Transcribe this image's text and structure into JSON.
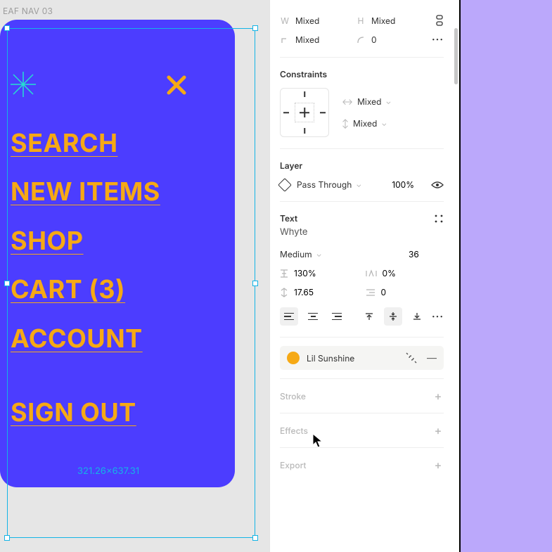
{
  "canvas": {
    "frame_label": "EAF NAV 03",
    "nav": {
      "items": [
        "SEARCH",
        "NEW ITEMS",
        "SHOP",
        "CART (3)",
        "ACCOUNT"
      ],
      "sign_out": "SIGN OUT"
    },
    "selection_dims": "321.26×637.31"
  },
  "inspector": {
    "size": {
      "w_label": "W",
      "w_value": "Mixed",
      "h_label": "H",
      "h_value": "Mixed",
      "rotation_value": "Mixed",
      "radius_value": "0"
    },
    "constraints": {
      "title": "Constraints",
      "horizontal": "Mixed",
      "vertical": "Mixed"
    },
    "layer": {
      "title": "Layer",
      "blend_mode": "Pass Through",
      "opacity": "100%"
    },
    "text": {
      "title": "Text",
      "font_family": "Whyte",
      "font_weight": "Medium",
      "font_size": "36",
      "line_height": "130%",
      "letter_spacing": "0%",
      "paragraph_spacing": "17.65",
      "paragraph_indent": "0"
    },
    "fill": {
      "style_name": "Lil Sunshine",
      "swatch_color": "#F6A915"
    },
    "stroke": {
      "title": "Stroke"
    },
    "effects": {
      "title": "Effects"
    },
    "export": {
      "title": "Export"
    }
  }
}
